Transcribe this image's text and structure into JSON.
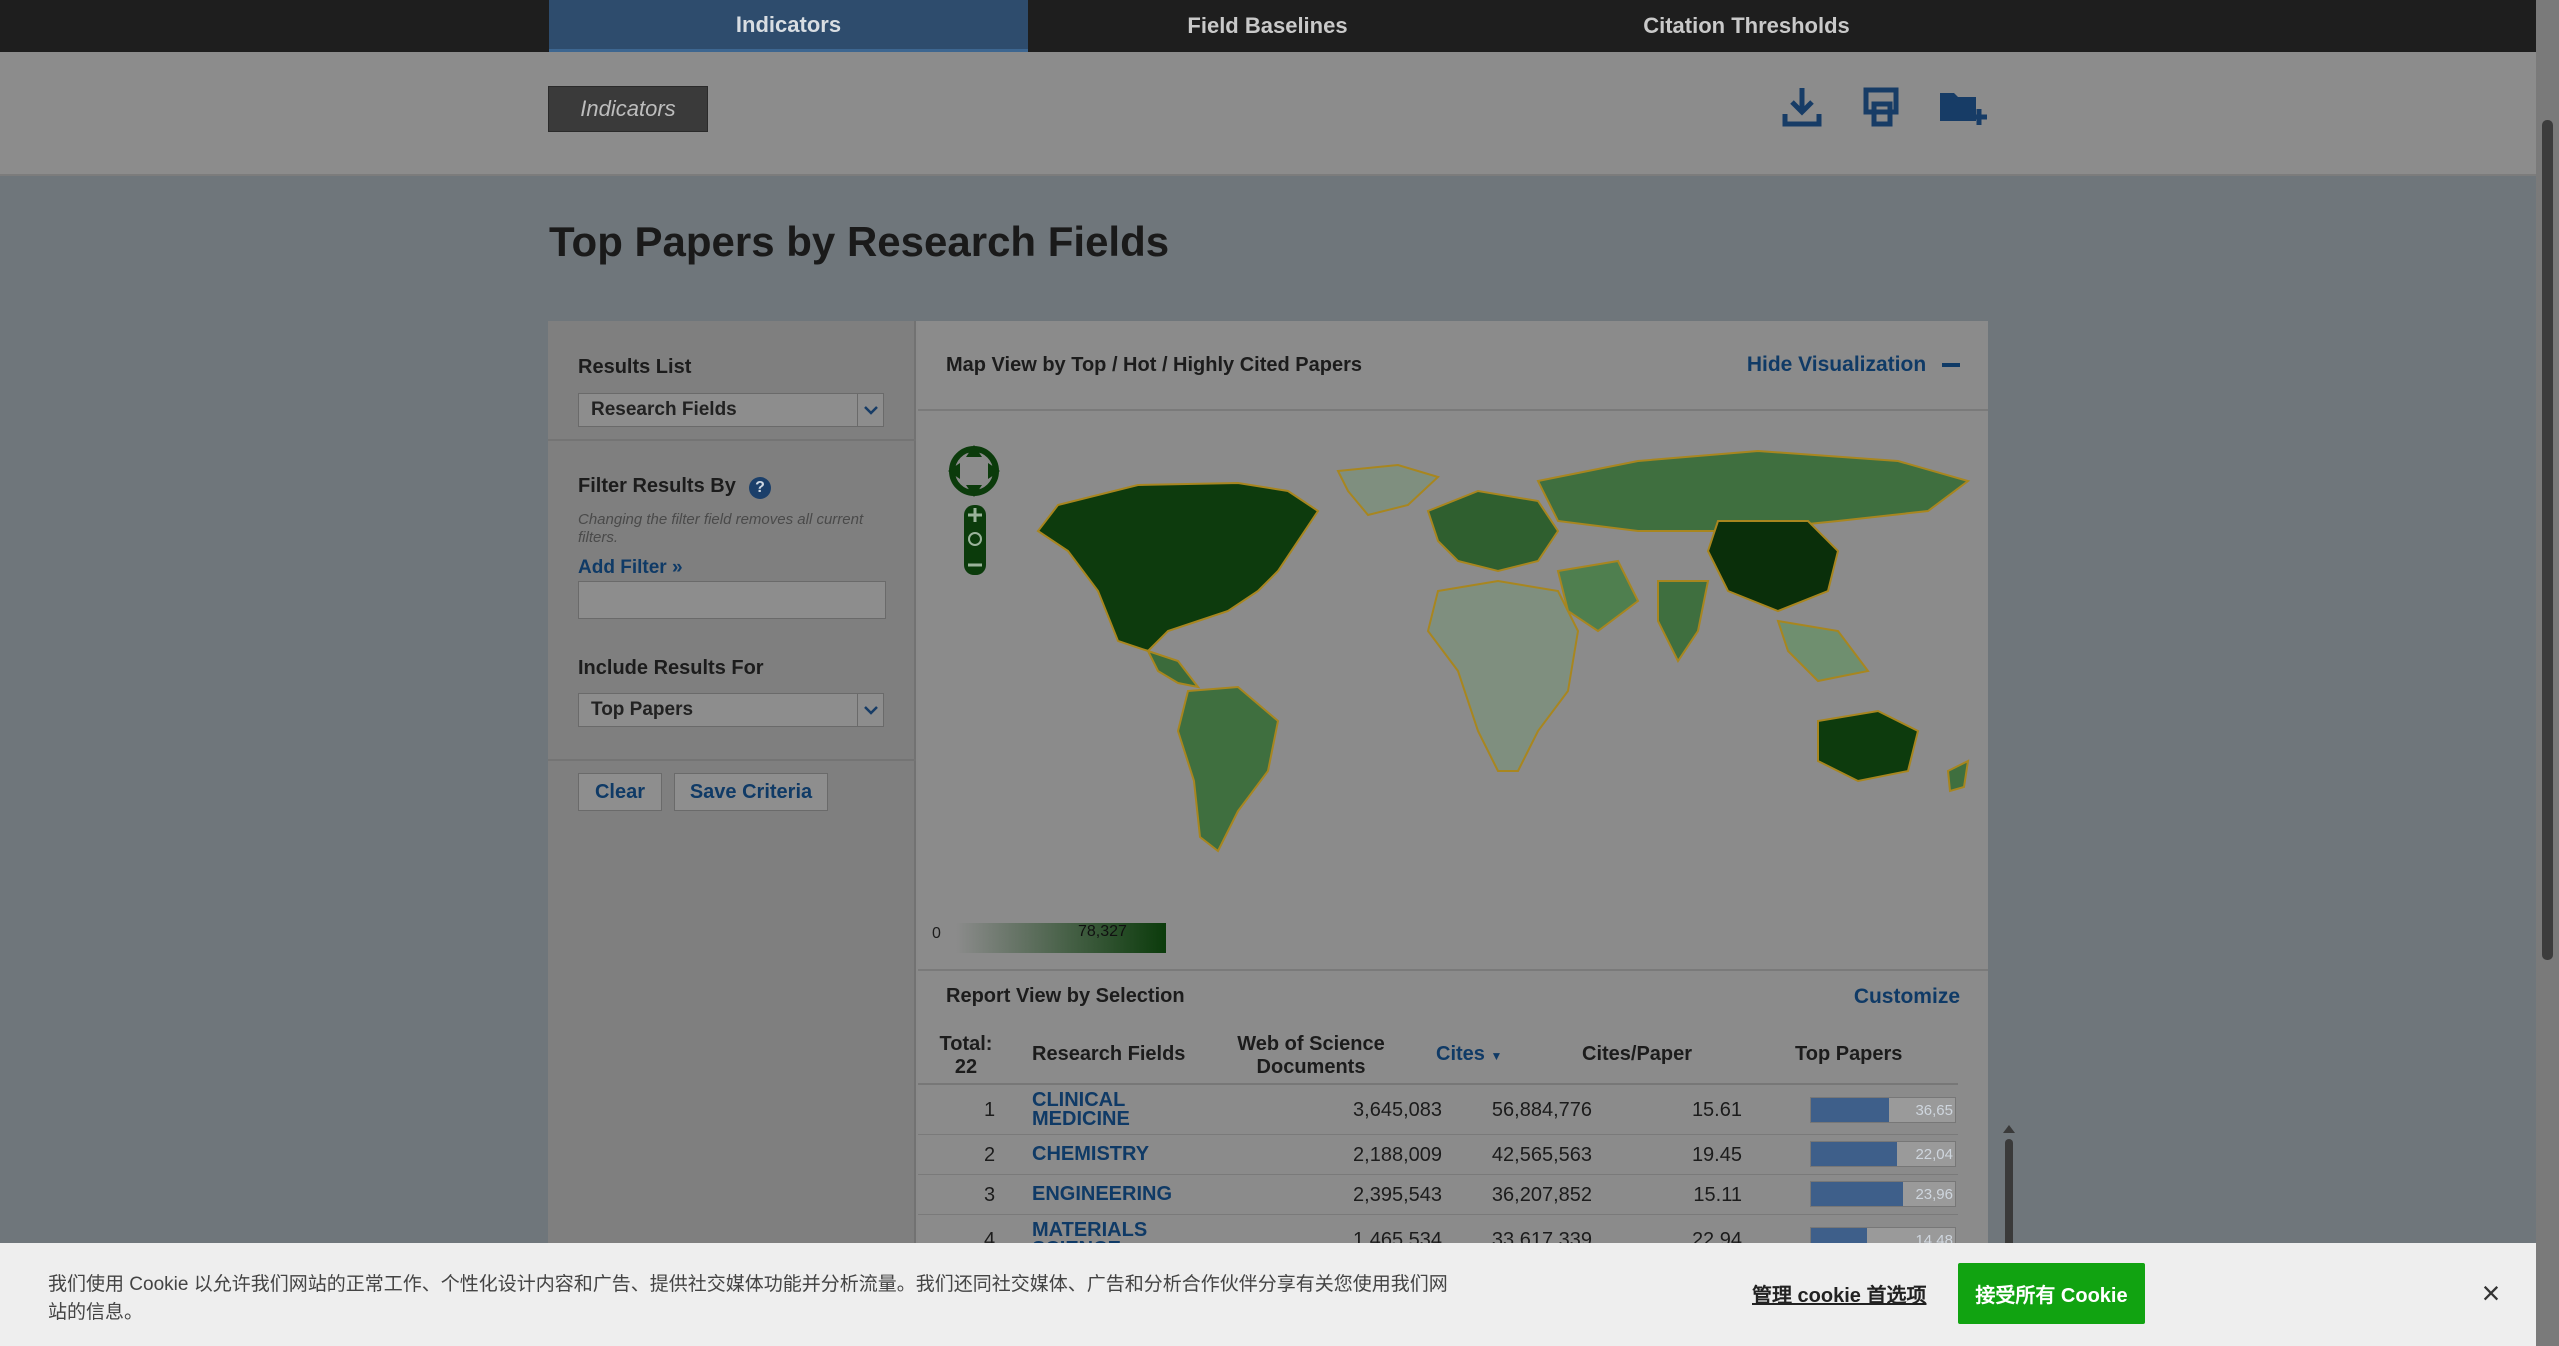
{
  "nav": {
    "tabs": [
      "Indicators",
      "Field Baselines",
      "Citation Thresholds"
    ]
  },
  "toolbar": {
    "breadcrumb": "Indicators"
  },
  "page": {
    "title": "Top Papers by Research Fields"
  },
  "sidebar": {
    "results_list_label": "Results List",
    "results_list_value": "Research Fields",
    "filter_label": "Filter Results By",
    "filter_help": "?",
    "filter_note": "Changing the filter field removes all current filters.",
    "add_filter": "Add Filter »",
    "include_label": "Include Results For",
    "include_value": "Top Papers",
    "clear": "Clear",
    "save": "Save Criteria"
  },
  "viz": {
    "title": "Map View by Top / Hot / Highly Cited Papers",
    "hide": "Hide Visualization",
    "legend_min": "0",
    "legend_max": "78,327"
  },
  "report": {
    "title": "Report View by Selection",
    "customize": "Customize",
    "headers": {
      "total_label": "Total:",
      "total": "22",
      "field": "Research Fields",
      "docs": "Web of Science Documents",
      "cites": "Cites",
      "cpp": "Cites/Paper",
      "top": "Top Papers"
    },
    "rows": [
      {
        "rank": "1",
        "field": "CLINICAL MEDICINE",
        "docs": "3,645,083",
        "cites": "56,884,776",
        "cpp": "15.61",
        "top": "36,65",
        "frac": 0.54
      },
      {
        "rank": "2",
        "field": "CHEMISTRY",
        "docs": "2,188,009",
        "cites": "42,565,563",
        "cpp": "19.45",
        "top": "22,04",
        "frac": 0.6
      },
      {
        "rank": "3",
        "field": "ENGINEERING",
        "docs": "2,395,543",
        "cites": "36,207,852",
        "cpp": "15.11",
        "top": "23,96",
        "frac": 0.64
      },
      {
        "rank": "4",
        "field": "MATERIALS SCIENCE",
        "docs": "1,465,534",
        "cites": "33,617,339",
        "cpp": "22.94",
        "top": "14,48",
        "frac": 0.39
      }
    ]
  },
  "cookie": {
    "text": "我们使用 Cookie 以允许我们网站的正常工作、个性化设计内容和广告、提供社交媒体功能并分析流量。我们还同社交媒体、广告和分析合作伙伴分享有关您使用我们网站的信息。",
    "manage": "管理 cookie 首选项",
    "accept": "接受所有 Cookie",
    "close": "×"
  }
}
